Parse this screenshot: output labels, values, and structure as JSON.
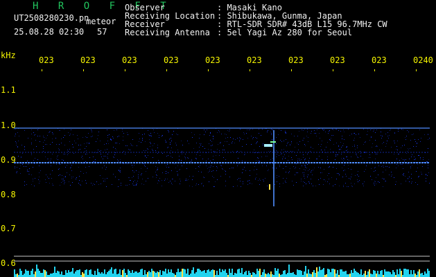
{
  "header": {
    "app_title": "H R O F F T",
    "file_name": "UT2508280230.pn",
    "tag": "meteor",
    "datetime": "25.08.28 02:30",
    "count": "57",
    "info": [
      {
        "label": "Observer",
        "value": ": Masaki Kano"
      },
      {
        "label": "Receiving Location",
        "value": ": Shibukawa, Gunma, Japan"
      },
      {
        "label": "Receiver",
        "value": ": RTL-SDR SDR# 43dB L15 96.7MHz CW"
      },
      {
        "label": "Receiving Antenna",
        "value": ": 5el Yagi Az 280 for Seoul"
      }
    ]
  },
  "axis": {
    "unit": "kHz",
    "time_ticks": [
      "023",
      "023",
      "023",
      "023",
      "023",
      "023",
      "023",
      "023",
      "023",
      "0240"
    ],
    "freq_ticks": [
      "1.1",
      "1.0",
      "0.9",
      "0.8",
      "0.7",
      "0.6"
    ]
  },
  "colors": {
    "background": "#000000",
    "noise": "#1b3cff",
    "carrier": "#4f8dff",
    "echo": "#a6f0ff",
    "spectrum": "#22d3ee",
    "spectrum_peak": "#fde047"
  }
}
